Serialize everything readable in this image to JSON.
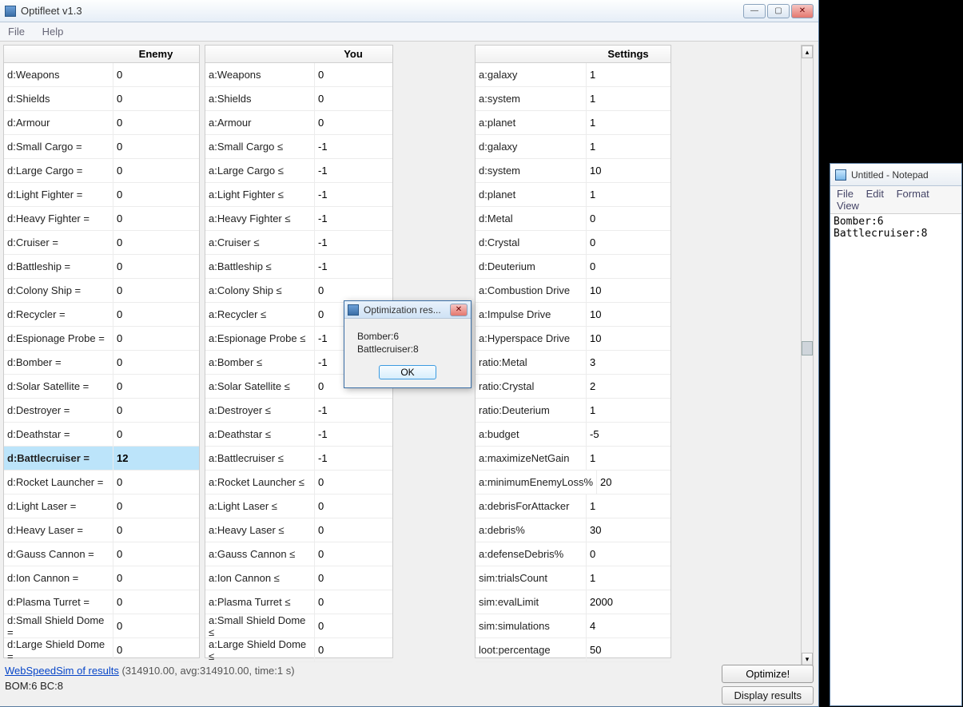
{
  "main": {
    "title": "Optifleet v1.3",
    "menu": {
      "file": "File",
      "help": "Help"
    },
    "headers": {
      "enemy": "Enemy",
      "you": "You",
      "settings": "Settings"
    },
    "enemy": [
      {
        "label": "d:Weapons",
        "value": "0"
      },
      {
        "label": "d:Shields",
        "value": "0"
      },
      {
        "label": "d:Armour",
        "value": "0"
      },
      {
        "label": "d:Small Cargo =",
        "value": "0"
      },
      {
        "label": "d:Large Cargo =",
        "value": "0"
      },
      {
        "label": "d:Light Fighter =",
        "value": "0"
      },
      {
        "label": "d:Heavy Fighter =",
        "value": "0"
      },
      {
        "label": "d:Cruiser =",
        "value": "0"
      },
      {
        "label": "d:Battleship =",
        "value": "0"
      },
      {
        "label": "d:Colony Ship =",
        "value": "0"
      },
      {
        "label": "d:Recycler =",
        "value": "0"
      },
      {
        "label": "d:Espionage Probe =",
        "value": "0"
      },
      {
        "label": "d:Bomber =",
        "value": "0"
      },
      {
        "label": "d:Solar Satellite =",
        "value": "0"
      },
      {
        "label": "d:Destroyer =",
        "value": "0"
      },
      {
        "label": "d:Deathstar =",
        "value": "0"
      },
      {
        "label": "d:Battlecruiser =",
        "value": "12",
        "selected": true
      },
      {
        "label": "d:Rocket Launcher =",
        "value": "0"
      },
      {
        "label": "d:Light Laser =",
        "value": "0"
      },
      {
        "label": "d:Heavy Laser =",
        "value": "0"
      },
      {
        "label": "d:Gauss Cannon =",
        "value": "0"
      },
      {
        "label": "d:Ion Cannon =",
        "value": "0"
      },
      {
        "label": "d:Plasma Turret =",
        "value": "0"
      },
      {
        "label": "d:Small Shield Dome =",
        "value": "0"
      },
      {
        "label": "d:Large Shield Dome =",
        "value": "0"
      }
    ],
    "you": [
      {
        "label": "a:Weapons",
        "value": "0"
      },
      {
        "label": "a:Shields",
        "value": "0"
      },
      {
        "label": "a:Armour",
        "value": "0"
      },
      {
        "label": "a:Small Cargo ≤",
        "value": "-1"
      },
      {
        "label": "a:Large Cargo ≤",
        "value": "-1"
      },
      {
        "label": "a:Light Fighter ≤",
        "value": "-1"
      },
      {
        "label": "a:Heavy Fighter ≤",
        "value": "-1"
      },
      {
        "label": "a:Cruiser ≤",
        "value": "-1"
      },
      {
        "label": "a:Battleship ≤",
        "value": "-1"
      },
      {
        "label": "a:Colony Ship ≤",
        "value": "0"
      },
      {
        "label": "a:Recycler ≤",
        "value": "0"
      },
      {
        "label": "a:Espionage Probe ≤",
        "value": "-1"
      },
      {
        "label": "a:Bomber ≤",
        "value": "-1"
      },
      {
        "label": "a:Solar Satellite ≤",
        "value": "0"
      },
      {
        "label": "a:Destroyer ≤",
        "value": "-1"
      },
      {
        "label": "a:Deathstar ≤",
        "value": "-1"
      },
      {
        "label": "a:Battlecruiser ≤",
        "value": "-1"
      },
      {
        "label": "a:Rocket Launcher ≤",
        "value": "0"
      },
      {
        "label": "a:Light Laser ≤",
        "value": "0"
      },
      {
        "label": "a:Heavy Laser ≤",
        "value": "0"
      },
      {
        "label": "a:Gauss Cannon ≤",
        "value": "0"
      },
      {
        "label": "a:Ion Cannon ≤",
        "value": "0"
      },
      {
        "label": "a:Plasma Turret ≤",
        "value": "0"
      },
      {
        "label": "a:Small Shield Dome ≤",
        "value": "0"
      },
      {
        "label": "a:Large Shield Dome ≤",
        "value": "0"
      }
    ],
    "settings": [
      {
        "label": "a:galaxy",
        "value": "1"
      },
      {
        "label": "a:system",
        "value": "1"
      },
      {
        "label": "a:planet",
        "value": "1"
      },
      {
        "label": "d:galaxy",
        "value": "1"
      },
      {
        "label": "d:system",
        "value": "10"
      },
      {
        "label": "d:planet",
        "value": "1"
      },
      {
        "label": "d:Metal",
        "value": "0"
      },
      {
        "label": "d:Crystal",
        "value": "0"
      },
      {
        "label": "d:Deuterium",
        "value": "0"
      },
      {
        "label": "a:Combustion Drive",
        "value": "10"
      },
      {
        "label": "a:Impulse Drive",
        "value": "10"
      },
      {
        "label": "a:Hyperspace Drive",
        "value": "10"
      },
      {
        "label": "ratio:Metal",
        "value": "3"
      },
      {
        "label": "ratio:Crystal",
        "value": "2"
      },
      {
        "label": "ratio:Deuterium",
        "value": "1"
      },
      {
        "label": "a:budget",
        "value": "-5"
      },
      {
        "label": "a:maximizeNetGain",
        "value": "1"
      },
      {
        "label": "a:minimumEnemyLoss%",
        "value": "20"
      },
      {
        "label": "a:debrisForAttacker",
        "value": "1"
      },
      {
        "label": "a:debris%",
        "value": "30"
      },
      {
        "label": "a:defenseDebris%",
        "value": "0"
      },
      {
        "label": "sim:trialsCount",
        "value": "1"
      },
      {
        "label": "sim:evalLimit",
        "value": "2000"
      },
      {
        "label": "sim:simulations",
        "value": "4"
      },
      {
        "label": "loot:percentage",
        "value": "50"
      }
    ],
    "footer": {
      "link": "WebSpeedSim of results",
      "meta": "(314910.00, avg:314910.00, time:1 s)",
      "status": "BOM:6 BC:8",
      "optimize": "Optimize!",
      "display": "Display results"
    }
  },
  "dialog": {
    "title": "Optimization res...",
    "line1": "Bomber:6",
    "line2": "Battlecruiser:8",
    "ok": "OK"
  },
  "notepad": {
    "title": "Untitled - Notepad",
    "menu": {
      "file": "File",
      "edit": "Edit",
      "format": "Format",
      "view": "View"
    },
    "text": "Bomber:6\nBattlecruiser:8"
  }
}
